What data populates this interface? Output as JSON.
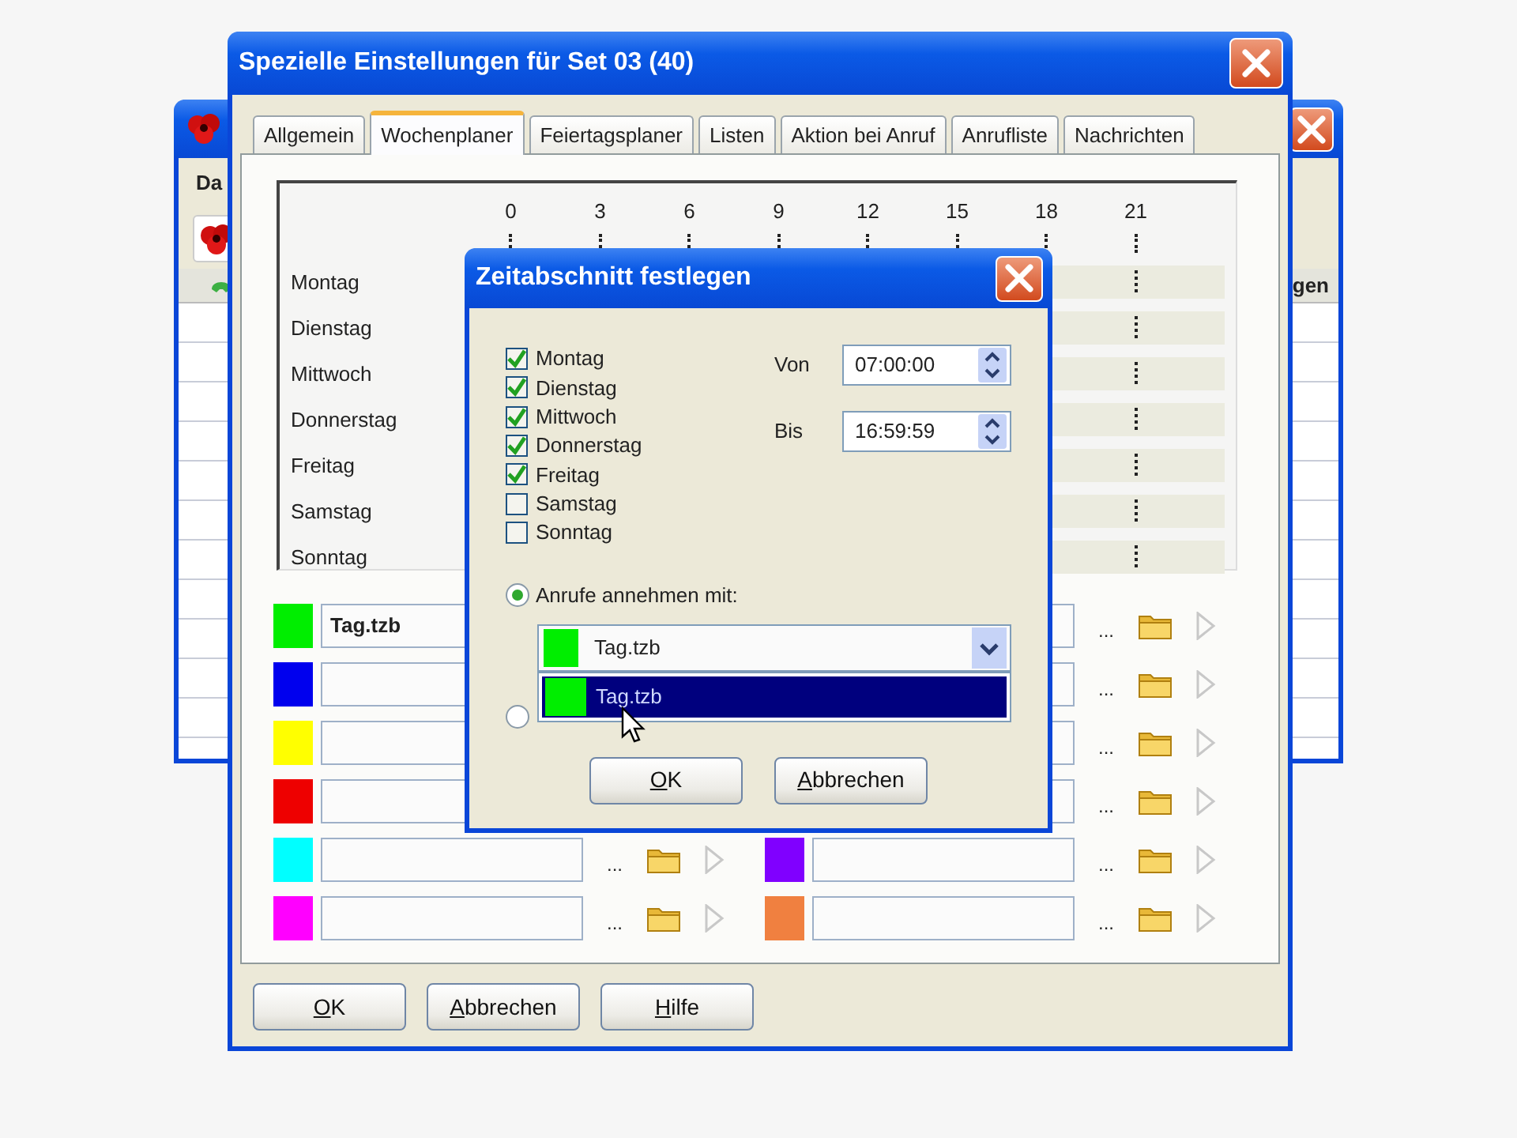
{
  "background_window": {
    "menu": [
      "Da"
    ],
    "column_header": "gen"
  },
  "window": {
    "title": "Spezielle Einstellungen für Set 03 (40)",
    "tabs": [
      {
        "label": "Allgemein",
        "selected": false
      },
      {
        "label": "Wochenplaner",
        "selected": true
      },
      {
        "label": "Feiertagsplaner",
        "selected": false
      },
      {
        "label": "Listen",
        "selected": false
      },
      {
        "label": "Aktion bei Anruf",
        "selected": false
      },
      {
        "label": "Anrufliste",
        "selected": false
      },
      {
        "label": "Nachrichten",
        "selected": false
      }
    ],
    "week_planner": {
      "hours": [
        "0",
        "3",
        "6",
        "9",
        "12",
        "15",
        "18",
        "21"
      ],
      "days": [
        "Montag",
        "Dienstag",
        "Mittwoch",
        "Donnerstag",
        "Freitag",
        "Samstag",
        "Sonntag"
      ]
    },
    "file_slots": {
      "left": [
        {
          "color": "#00ee00",
          "value": "Tag.tzb"
        },
        {
          "color": "#0000ee"
        },
        {
          "color": "#ffff00"
        },
        {
          "color": "#ee0000"
        },
        {
          "color": "#00ffff",
          "dots": "..."
        },
        {
          "color": "#ff00ff",
          "dots": "..."
        }
      ],
      "right": [
        {
          "dots": "..."
        },
        {
          "dots": "..."
        },
        {
          "dots": "..."
        },
        {
          "dots": "..."
        },
        {
          "color": "#8000ff",
          "dots": "..."
        },
        {
          "color": "#f08040",
          "dots": "..."
        }
      ]
    },
    "buttons": [
      {
        "label": "OK",
        "mnemonic": true
      },
      {
        "label": "Abbrechen",
        "mnemonic": true
      },
      {
        "label": "Hilfe",
        "mnemonic": true
      }
    ]
  },
  "dialog": {
    "title": "Zeitabschnitt festlegen",
    "days": [
      {
        "label": "Montag",
        "checked": true
      },
      {
        "label": "Dienstag",
        "checked": true
      },
      {
        "label": "Mittwoch",
        "checked": true
      },
      {
        "label": "Donnerstag",
        "checked": true
      },
      {
        "label": "Freitag",
        "checked": true
      },
      {
        "label": "Samstag",
        "checked": false
      },
      {
        "label": "Sonntag",
        "checked": false
      }
    ],
    "from": {
      "label": "Von",
      "value": "07:00:00"
    },
    "to": {
      "label": "Bis",
      "value": "16:59:59"
    },
    "options": [
      {
        "label": "Anrufe annehmen mit:",
        "selected": true
      },
      {
        "selected": false
      }
    ],
    "combo": {
      "color": "#00ee00",
      "value": "Tag.tzb"
    },
    "dropdown_items": [
      {
        "color": "#00ee00",
        "label": "Tag.tzb",
        "selected": true
      }
    ],
    "buttons": [
      {
        "label": "OK",
        "mnemonic": true
      },
      {
        "label": "Abbrechen",
        "mnemonic": true
      }
    ]
  }
}
